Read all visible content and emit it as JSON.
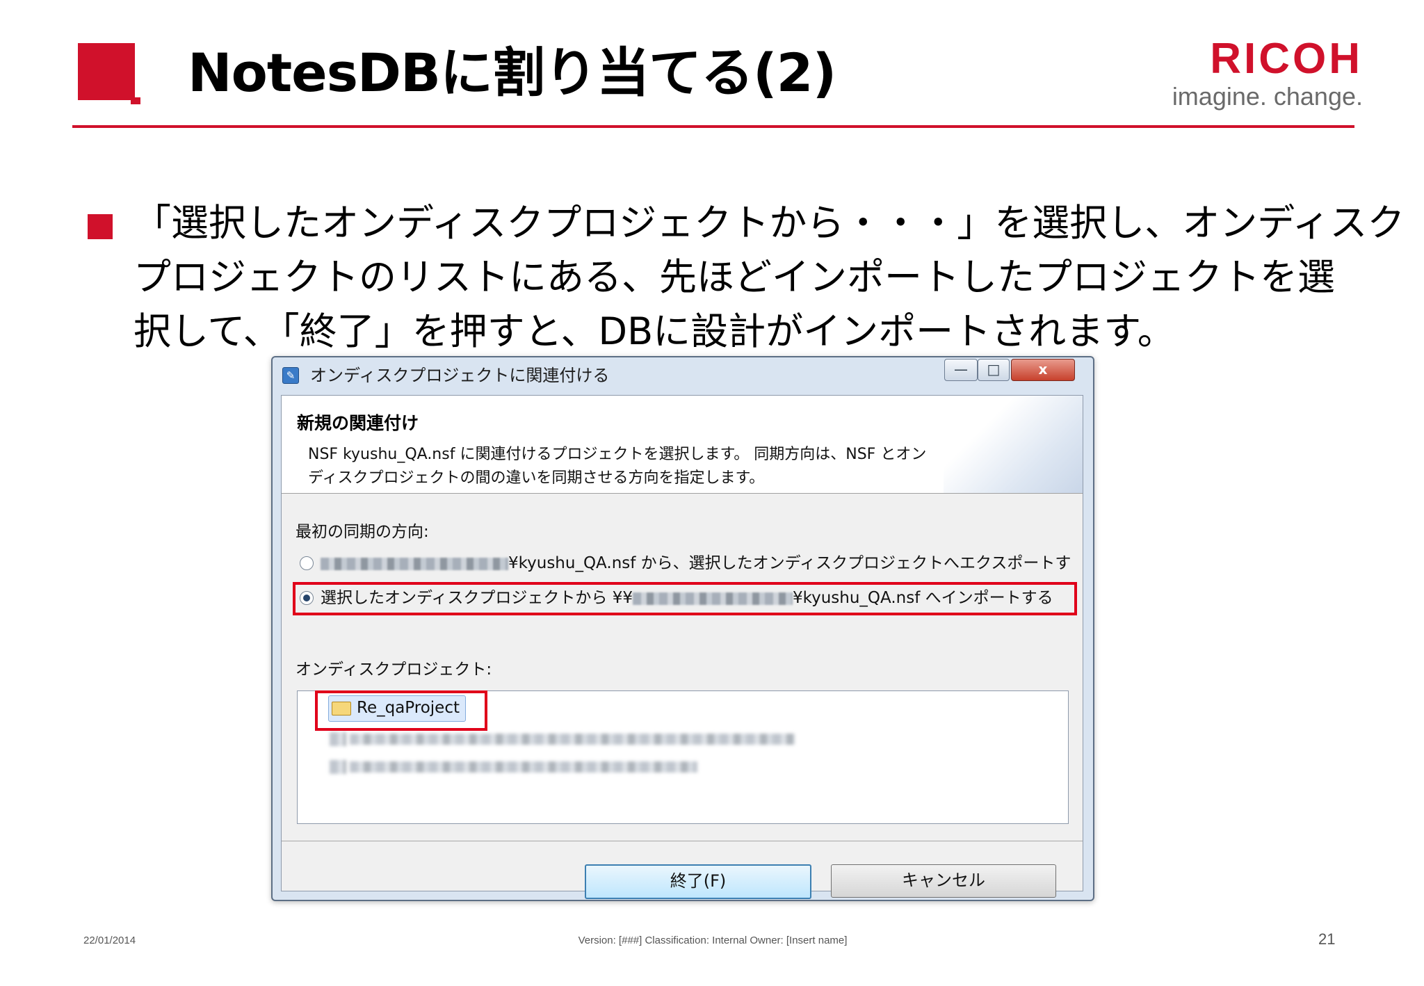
{
  "slide": {
    "title": "NotesDBに割り当てる(2)",
    "logo_word": "RICOH",
    "logo_tagline": "imagine. change.",
    "body_lines": [
      "「選択したオンディスクプロジェクトから・・・」を選択し、オンディスク",
      "プロジェクトのリストにある、先ほどインポートしたプロジェクトを選",
      "択して、「終了」を押すと、DBに設計がインポートされます。"
    ]
  },
  "dialog": {
    "window_title": "オンディスクプロジェクトに関連付ける",
    "window_buttons": {
      "minimize": "—",
      "maximize": "□",
      "close": "x"
    },
    "heading": "新規の関連付け",
    "description_lines": [
      "NSF kyushu_QA.nsf に関連付けるプロジェクトを選択します。 同期方向は、NSF とオン",
      "ディスクプロジェクトの間の違いを同期させる方向を指定します。"
    ],
    "sync_label": "最初の同期の方向:",
    "radio_export": {
      "suffix": "¥kyushu_QA.nsf から、選択したオンディスクプロジェクトへエクスポートす",
      "checked": false
    },
    "radio_import": {
      "prefix": "選択したオンディスクプロジェクトから ¥¥",
      "suffix": "¥kyushu_QA.nsf へインポートする",
      "checked": true
    },
    "projects_label": "オンディスクプロジェクト:",
    "selected_project": "Re_qaProject",
    "finish_button": "終了(F)",
    "cancel_button": "キャンセル",
    "highlight_color": "#e0001a"
  },
  "footer": {
    "date": "22/01/2014",
    "info": "Version: [###] Classification: Internal  Owner: [Insert name]",
    "page": "21"
  },
  "colors": {
    "brand_red": "#d0112b"
  }
}
